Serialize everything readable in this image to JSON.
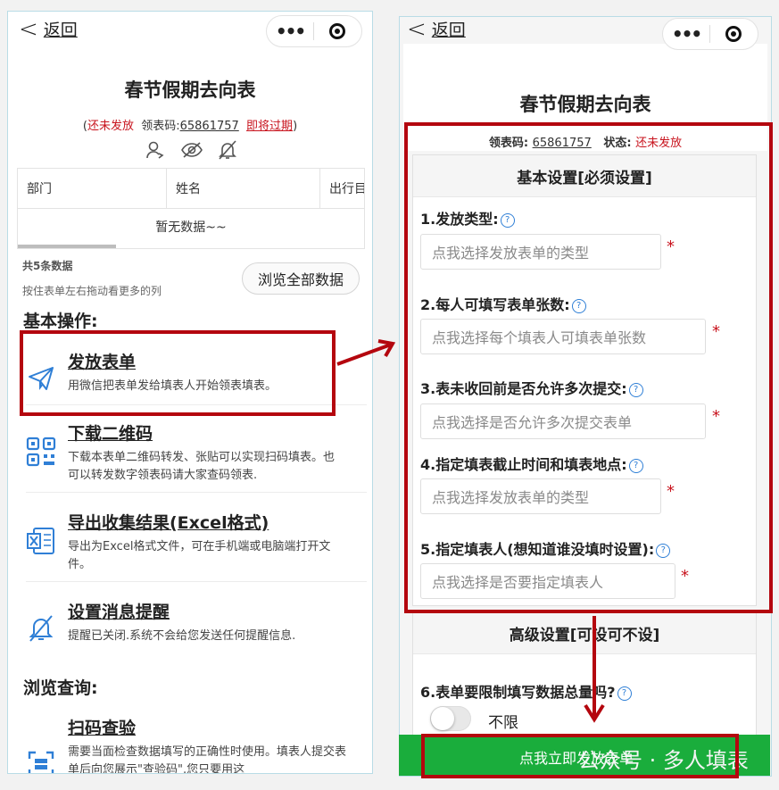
{
  "left": {
    "nav_back": "返回",
    "title": "春节假期去向表",
    "sub": {
      "status": "还未发放",
      "code_label": "领表码:",
      "code": "65861757",
      "expire": "即将过期"
    },
    "table": {
      "columns": [
        "部门",
        "姓名",
        "出行目"
      ],
      "empty": "暂无数据~~"
    },
    "count_text": "共5条数据",
    "hint_text": "按住表单左右拖动看更多的列",
    "browse_all": "浏览全部数据",
    "basic_ops_title": "基本操作:",
    "ops": [
      {
        "title": "发放表单",
        "desc": "用微信把表单发给填表人开始领表填表。"
      },
      {
        "title": "下载二维码",
        "desc": "下载本表单二维码转发、张贴可以实现扫码填表。也可以转发数字领表码请大家查码领表."
      },
      {
        "title": "导出收集结果(Excel格式)",
        "desc": "导出为Excel格式文件，可在手机端或电脑端打开文件。"
      },
      {
        "title": "设置消息提醒",
        "desc": "提醒已关闭.系统不会给您发送任何提醒信息."
      }
    ],
    "browse_title": "浏览查询:",
    "scan": {
      "title": "扫码查验",
      "desc": "需要当面检查数据填写的正确性时使用。填表人提交表单后向您展示\"查验码\".您只要用这"
    }
  },
  "right": {
    "nav_back": "返回",
    "title": "春节假期去向表",
    "code_label": "领表码:",
    "code": "65861757",
    "status_label": "状态:",
    "status": "还未发放",
    "basic_head": "基本设置[必须设置]",
    "questions": [
      {
        "label": "1.发放类型:",
        "placeholder": "点我选择发放表单的类型"
      },
      {
        "label": "2.每人可填写表单张数:",
        "placeholder": "点我选择每个填表人可填表单张数"
      },
      {
        "label": "3.表未收回前是否允许多次提交:",
        "placeholder": "点我选择是否允许多次提交表单"
      },
      {
        "label": "4.指定填表截止时间和填表地点:",
        "placeholder": "点我选择发放表单的类型"
      },
      {
        "label": "5.指定填表人(想知道谁没填时设置):",
        "placeholder": "点我选择是否要指定填表人"
      }
    ],
    "required_mark": "*",
    "help_mark": "?",
    "advanced_head": "高级设置[可设可不设]",
    "q6_label": "6.表单要限制填写数据总量吗?",
    "q6_value": "不限",
    "publish_button": "点我立即发放表单"
  },
  "watermark": "公众号 · 多人填表",
  "colors": {
    "accent_red": "#c8141e",
    "box_red": "#b4060e",
    "icon_blue": "#2f7fd6",
    "green": "#1aad3c"
  }
}
